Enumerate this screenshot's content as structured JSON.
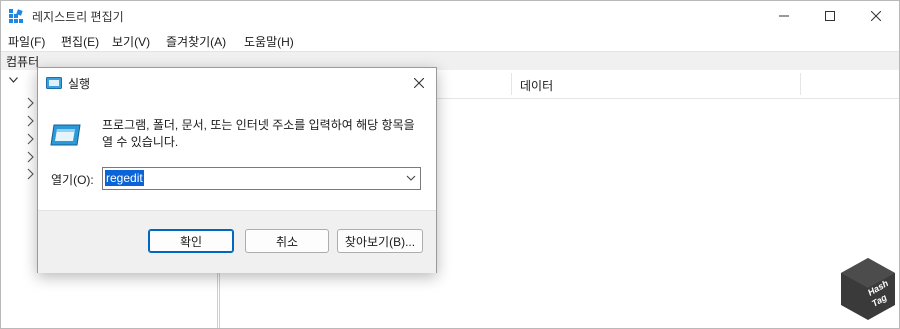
{
  "window": {
    "title": "레지스트리 편집기",
    "controls": [
      "minimize-icon",
      "maximize-icon",
      "close-icon"
    ]
  },
  "menu": {
    "items": [
      {
        "label": "파일(F)"
      },
      {
        "label": "편집(E)"
      },
      {
        "label": "보기(V)"
      },
      {
        "label": "즐겨찾기(A)"
      },
      {
        "label": "도움말(H)"
      }
    ]
  },
  "address": {
    "path": "컴퓨터"
  },
  "list": {
    "columns": {
      "data": "데이터"
    }
  },
  "run_dialog": {
    "title": "실행",
    "description": "프로그램, 폴더, 문서, 또는 인터넷 주소를 입력하여 해당 항목을 열 수 있습니다.",
    "open_label": "열기(O):",
    "open_value": "regedit",
    "buttons": {
      "ok": "확인",
      "cancel": "취소",
      "browse": "찾아보기(B)..."
    }
  },
  "watermark": {
    "text": "HashTag"
  },
  "colors": {
    "accent": "#0067c0",
    "selection": "#0a64d8",
    "dialog_footer": "#f0f0f0"
  }
}
